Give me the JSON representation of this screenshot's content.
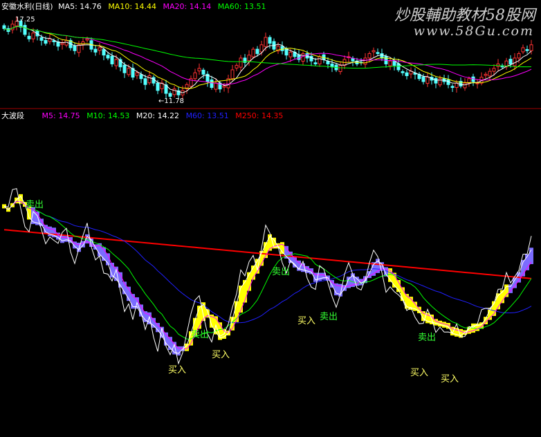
{
  "top_panel": {
    "title": "安徽水利(日线)",
    "legend": [
      {
        "label": "MA5: 14.76",
        "color": "#ffffff"
      },
      {
        "label": "MA10: 14.44",
        "color": "#ffff00"
      },
      {
        "label": "MA20: 14.14",
        "color": "#ff00ff"
      },
      {
        "label": "MA60: 13.51",
        "color": "#00ff00"
      }
    ],
    "high_label": "17.25",
    "low_label": "←11.78"
  },
  "bottom_panel": {
    "title": "大波段",
    "legend": [
      {
        "label": "M5: 14.75",
        "color": "#ff00ff"
      },
      {
        "label": "M10: 14.53",
        "color": "#00ff00"
      },
      {
        "label": "M20: 14.22",
        "color": "#ffffff"
      },
      {
        "label": "M60: 13.51",
        "color": "#2020ff"
      },
      {
        "label": "M250: 14.35",
        "color": "#ff0000"
      }
    ],
    "signals": [
      {
        "text": "卖出",
        "color": "#33ff33"
      },
      {
        "text": "买入",
        "color": "#ffff66"
      },
      {
        "text": "卖出",
        "color": "#33ff33"
      },
      {
        "text": "买入",
        "color": "#ffff66"
      },
      {
        "text": "卖出",
        "color": "#33ff33"
      },
      {
        "text": "买入",
        "color": "#ffff66"
      },
      {
        "text": "卖出",
        "color": "#33ff33"
      },
      {
        "text": "卖出",
        "color": "#33ff33"
      },
      {
        "text": "买入",
        "color": "#ffff66"
      },
      {
        "text": "买入",
        "color": "#ffff66"
      }
    ]
  },
  "watermark": {
    "line1": "炒股輔助教材58股网",
    "line2": "www.58Gu.com"
  },
  "chart_data": [
    {
      "type": "candlestick",
      "panel": "top",
      "price_high": 17.25,
      "price_low": 11.78,
      "ylim": [
        11.5,
        17.6
      ],
      "closes": [
        16.6,
        16.4,
        16.9,
        17.1,
        16.7,
        16.2,
        15.9,
        16.3,
        16.1,
        15.8,
        15.6,
        15.9,
        15.7,
        15.4,
        15.6,
        15.8,
        15.3,
        15.1,
        15.5,
        15.7,
        15.9,
        15.2,
        15.0,
        15.3,
        14.8,
        14.6,
        14.2,
        14.5,
        14.0,
        13.6,
        13.9,
        13.3,
        13.6,
        13.2,
        12.8,
        13.4,
        12.9,
        12.4,
        12.9,
        12.2,
        12.0,
        12.5,
        12.1,
        12.4,
        12.8,
        13.2,
        13.6,
        13.9,
        13.5,
        13.0,
        12.6,
        12.9,
        12.5,
        12.7,
        13.2,
        13.8,
        14.1,
        14.6,
        14.3,
        14.8,
        15.2,
        14.9,
        15.5,
        16.0,
        15.6,
        15.2,
        15.4,
        15.1,
        14.8,
        15.0,
        14.7,
        14.5,
        14.9,
        14.6,
        14.4,
        14.2,
        14.7,
        14.5,
        14.2,
        14.0,
        13.8,
        14.1,
        14.5,
        14.7,
        14.4,
        14.2,
        14.3,
        14.6,
        14.9,
        15.1,
        14.9,
        14.6,
        14.2,
        14.4,
        14.1,
        13.8,
        13.6,
        13.4,
        13.7,
        13.5,
        13.2,
        13.0,
        13.3,
        13.1,
        12.9,
        13.2,
        13.0,
        12.8,
        12.6,
        12.9,
        12.7,
        12.9,
        13.2,
        13.0,
        12.9,
        13.3,
        13.5,
        13.7,
        13.9,
        14.2,
        14.0,
        14.4,
        14.2,
        14.6,
        14.9,
        15.3,
        15.1,
        15.5
      ]
    },
    {
      "type": "line",
      "panel": "bottom",
      "series": [
        {
          "name": "M5",
          "color": "#ff00ff"
        },
        {
          "name": "M10",
          "color": "#00ff00"
        },
        {
          "name": "M20",
          "color": "#ffffff"
        },
        {
          "name": "M60",
          "color": "#2020ff"
        },
        {
          "name": "M250",
          "color": "#ff0000"
        }
      ],
      "band_state": [
        "up",
        "up",
        "up",
        "up",
        "up",
        "up",
        "up",
        "down",
        "down",
        "down",
        "down",
        "down",
        "down",
        "down",
        "down",
        "down",
        "down",
        "down",
        "down",
        "down",
        "down",
        "down",
        "down",
        "down",
        "down",
        "down",
        "down",
        "down",
        "down",
        "down",
        "down",
        "down",
        "down",
        "down",
        "down",
        "down",
        "down",
        "down",
        "down",
        "down",
        "down",
        "down",
        "down",
        "down",
        "up",
        "up",
        "up",
        "up",
        "up",
        "up",
        "up",
        "up",
        "up",
        "up",
        "up",
        "up",
        "up",
        "up",
        "up",
        "up",
        "up",
        "up",
        "up",
        "up",
        "up",
        "up",
        "up",
        "up",
        "down",
        "down",
        "down",
        "down",
        "down",
        "down",
        "down",
        "down",
        "down",
        "down",
        "down",
        "down",
        "down",
        "down",
        "down",
        "down",
        "down",
        "down",
        "down",
        "down",
        "down",
        "down",
        "down",
        "down",
        "down",
        "up",
        "up",
        "up",
        "up",
        "up",
        "up",
        "up",
        "up",
        "up",
        "up",
        "up",
        "up",
        "up",
        "up",
        "up",
        "up",
        "up",
        "up",
        "up",
        "up",
        "up",
        "up",
        "up",
        "up",
        "up",
        "up",
        "up",
        "up",
        "up"
      ]
    }
  ]
}
